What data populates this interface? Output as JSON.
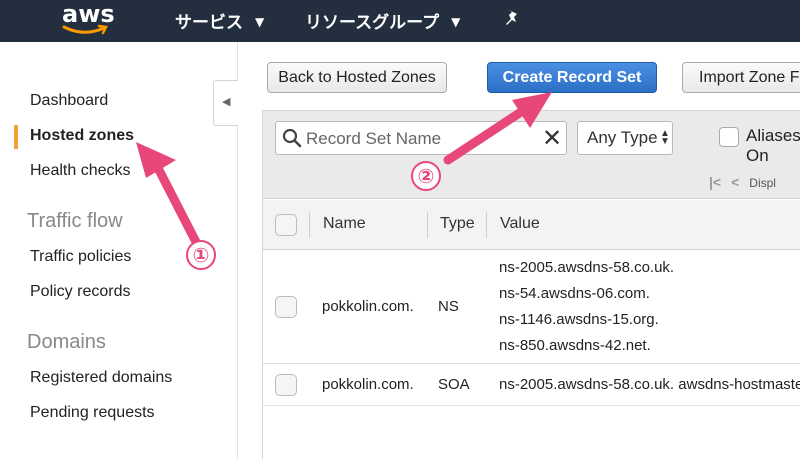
{
  "header": {
    "logo_text": "aws",
    "nav": [
      {
        "label": "サービス"
      },
      {
        "label": "リソースグループ"
      }
    ],
    "caret": "⌄"
  },
  "sidebar": {
    "items": [
      {
        "label": "Dashboard"
      },
      {
        "label": "Hosted zones"
      },
      {
        "label": "Health checks"
      }
    ],
    "section_traffic": "Traffic flow",
    "traffic_items": [
      {
        "label": "Traffic policies"
      },
      {
        "label": "Policy records"
      }
    ],
    "section_domains": "Domains",
    "domain_items": [
      {
        "label": "Registered domains"
      },
      {
        "label": "Pending requests"
      }
    ]
  },
  "toolbar": {
    "back_label": "Back to Hosted Zones",
    "create_label": "Create Record Set",
    "import_label": "Import Zone F"
  },
  "filter": {
    "search_placeholder": "Record Set Name",
    "clear": "✕",
    "type_value": "Any Type",
    "alias_label": "Aliases On",
    "pager_text": "Displ"
  },
  "table": {
    "columns": [
      "Name",
      "Type",
      "Value"
    ],
    "rows": [
      {
        "name": "pokkolin.com.",
        "type": "NS",
        "values": [
          "ns-2005.awsdns-58.co.uk.",
          "ns-54.awsdns-06.com.",
          "ns-1146.awsdns-15.org.",
          "ns-850.awsdns-42.net."
        ]
      },
      {
        "name": "pokkolin.com.",
        "type": "SOA",
        "values": [
          "ns-2005.awsdns-58.co.uk. awsdns-hostmaste"
        ]
      }
    ]
  },
  "annotations": [
    {
      "number": "①"
    },
    {
      "number": "②"
    }
  ],
  "colors": {
    "nav_bg": "#232f3e",
    "accent_orange": "#f0a33a",
    "primary_blue": "#2c6fc6",
    "annotation_pink": "#e8477a"
  }
}
